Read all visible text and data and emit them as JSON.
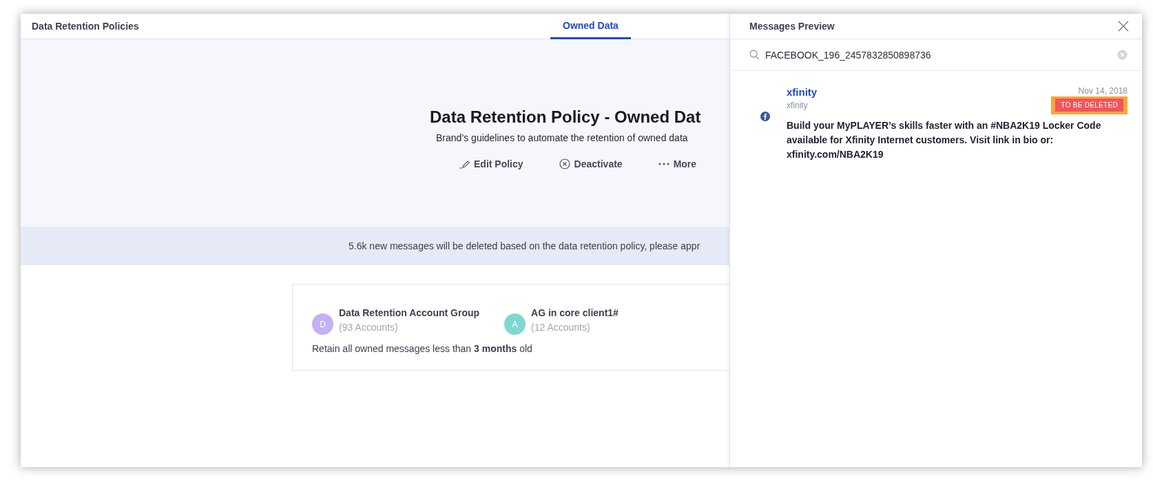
{
  "header": {
    "title": "Data Retention Policies",
    "tabs": [
      {
        "label": "Owned Data",
        "selected": true
      }
    ]
  },
  "policy": {
    "title": "Data Retention Policy - Owned Dat",
    "subtitle": "Brand’s guidelines to automate the retention of owned data",
    "actions": [
      {
        "kind": "edit",
        "label": "Edit Policy"
      },
      {
        "kind": "deactivate",
        "label": "Deactivate"
      },
      {
        "kind": "more",
        "label": "More"
      }
    ]
  },
  "banner": "5.6k new messages will be deleted based on the data retention policy, please appr",
  "card": {
    "groups": [
      {
        "initial": "D",
        "color": "#c3b1f4",
        "name": "Data Retention Account Group",
        "count": "(93 Accounts)"
      },
      {
        "initial": "A",
        "color": "#7fd8cf",
        "name": "AG in core client1#",
        "count": "(12 Accounts)"
      }
    ],
    "rule": "Retain all owned messages less than **3 months** old"
  },
  "preview": {
    "title": "Messages Preview",
    "search": {
      "value": "FACEBOOK_196_2457832850898736"
    },
    "message": {
      "name": "xfinity",
      "handle": "xfinity",
      "date": "Nov 14, 2018",
      "badge": "TO BE DELETED",
      "body": "Build your MyPLAYER’s skills faster with an #NBA2K19 Locker Code available for Xfinity Internet customers. Visit link in bio or: xfinity.com/NBA2K19"
    }
  }
}
